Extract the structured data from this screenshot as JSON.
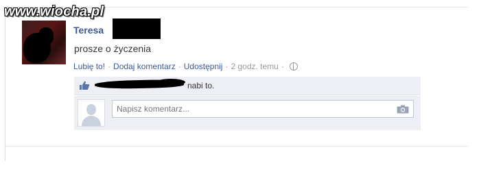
{
  "watermark": {
    "text": "www.wiocha.pl"
  },
  "post": {
    "author": "Teresa",
    "text": "prosze o życzenia"
  },
  "actions": {
    "like": "Lubię to!",
    "comment": "Dodaj komentarz",
    "share": "Udostępnij",
    "time": "2 godz. temu",
    "separator": "·"
  },
  "likes": {
    "text_suffix": "nabi to."
  },
  "comment": {
    "placeholder": "Napisz komentarz..."
  },
  "icons": {
    "globe": "globe-icon",
    "thumb": "thumbs-up-icon",
    "camera": "camera-icon"
  },
  "colors": {
    "link": "#3b5998",
    "panel": "#edeff4"
  }
}
